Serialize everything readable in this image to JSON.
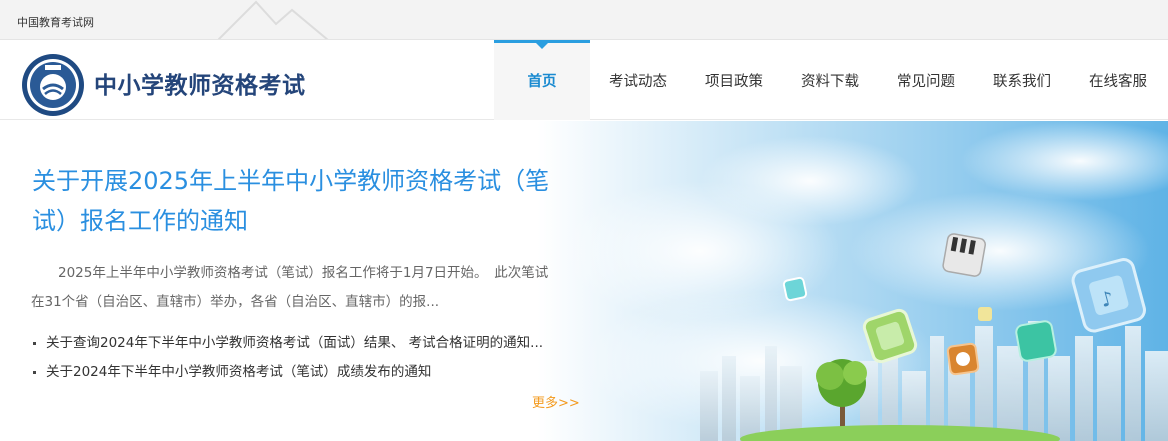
{
  "topbar": {
    "site_name": "中国教育考试网"
  },
  "header": {
    "brand_title": "中小学教师资格考试"
  },
  "nav": {
    "items": [
      {
        "label": "首页",
        "active": true
      },
      {
        "label": "考试动态"
      },
      {
        "label": "项目政策"
      },
      {
        "label": "资料下载"
      },
      {
        "label": "常见问题"
      },
      {
        "label": "联系我们"
      },
      {
        "label": "在线客服"
      }
    ]
  },
  "banner": {
    "headline": "关于开展2025年上半年中小学教师资格考试（笔试）报名工作的通知",
    "summary": "2025年上半年中小学教师资格考试（笔试）报名工作将于1月7日开始。　此次笔试在31个省（自治区、直辖市）举办，各省（自治区、直辖市）的报...",
    "news": [
      "关于查询2024年下半年中小学教师资格考试（面试）结果、 考试合格证明的通知...",
      "关于2024年下半年中小学教师资格考试（笔试）成绩发布的通知"
    ],
    "more_label": "更多>>"
  },
  "colors": {
    "accent": "#2a8fe0",
    "brand": "#24457a",
    "more": "#f39a1e"
  }
}
